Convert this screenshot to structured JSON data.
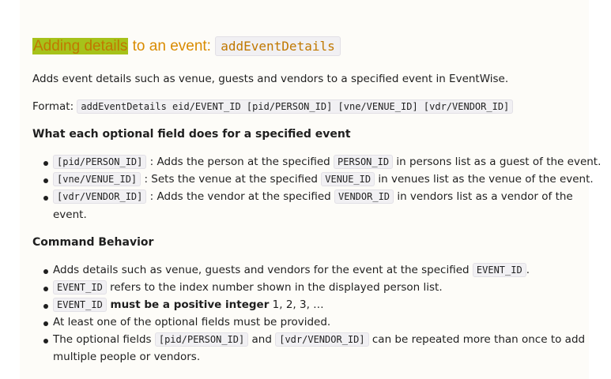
{
  "heading": {
    "highlight": "Adding details",
    "rest": " to an event: ",
    "code": "addEventDetails"
  },
  "intro": "Adds event details such as venue, guests and vendors to a specified event in EventWise.",
  "format": {
    "label": "Format: ",
    "code": "addEventDetails eid/EVENT_ID [pid/PERSON_ID] [vne/VENUE_ID] [vdr/VENDOR_ID]"
  },
  "optional_heading": "What each optional field does for a specified event",
  "optional_items": [
    {
      "code": "[pid/PERSON_ID]",
      "t1": " : Adds the person at the specified ",
      "code2": "PERSON_ID",
      "t2": " in persons list as a guest of the event."
    },
    {
      "code": "[vne/VENUE_ID]",
      "t1": " : Sets the venue at the specified ",
      "code2": "VENUE_ID",
      "t2": " in venues list as the venue of the event."
    },
    {
      "code": "[vdr/VENDOR_ID]",
      "t1": " : Adds the vendor at the specified ",
      "code2": "VENDOR_ID",
      "t2": " in vendors list as a vendor of the",
      "cont": "event."
    }
  ],
  "behavior_heading": "Command Behavior",
  "behavior_items": {
    "b1_text": "Adds details such as venue, guests and vendors for the event at the specified ",
    "b1_code": "EVENT_ID",
    "b1_end": ".",
    "b2_code": "EVENT_ID",
    "b2_text": " refers to the index number shown in the displayed person list.",
    "b3_code": "EVENT_ID",
    "b3_bold": " must be a positive integer",
    "b3_text": " 1, 2, 3, …",
    "b4_text": "At least one of the optional fields must be provided.",
    "b5_text1": "The optional fields ",
    "b5_code1": "[pid/PERSON_ID]",
    "b5_text2": " and ",
    "b5_code2": "[vdr/VENDOR_ID]",
    "b5_text3": " can be repeated more than once to add",
    "b5_cont": "multiple people or vendors."
  }
}
